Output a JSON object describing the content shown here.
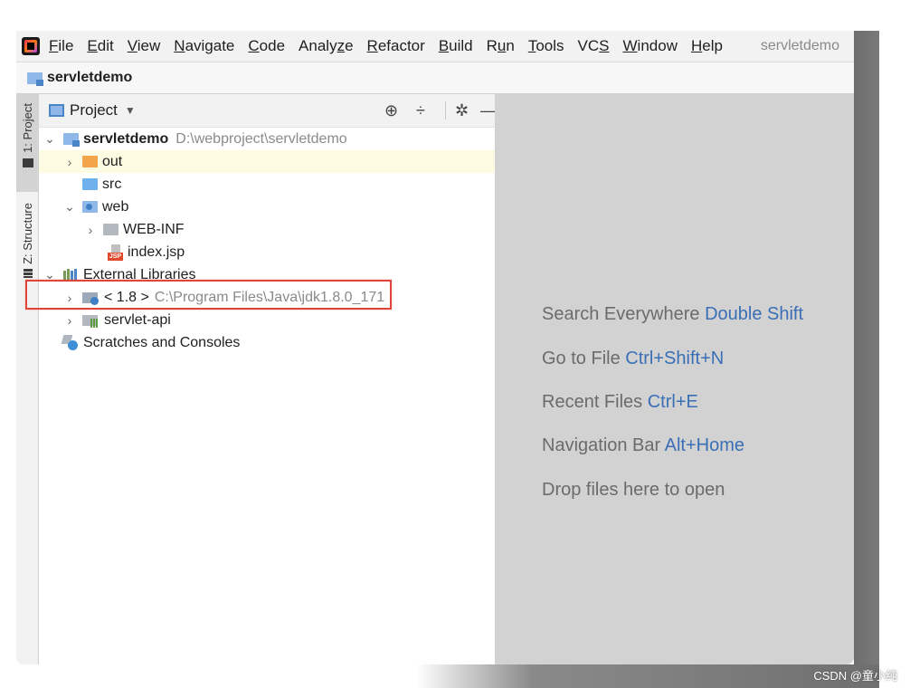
{
  "menubar": {
    "items": [
      {
        "pre": "",
        "u": "F",
        "post": "ile"
      },
      {
        "pre": "",
        "u": "E",
        "post": "dit"
      },
      {
        "pre": "",
        "u": "V",
        "post": "iew"
      },
      {
        "pre": "",
        "u": "N",
        "post": "avigate"
      },
      {
        "pre": "",
        "u": "C",
        "post": "ode"
      },
      {
        "pre": "Analy",
        "u": "z",
        "post": "e"
      },
      {
        "pre": "",
        "u": "R",
        "post": "efactor"
      },
      {
        "pre": "",
        "u": "B",
        "post": "uild"
      },
      {
        "pre": "R",
        "u": "u",
        "post": "n"
      },
      {
        "pre": "",
        "u": "T",
        "post": "ools"
      },
      {
        "pre": "VC",
        "u": "S",
        "post": ""
      },
      {
        "pre": "",
        "u": "W",
        "post": "indow"
      },
      {
        "pre": "",
        "u": "H",
        "post": "elp"
      }
    ],
    "project_title": "servletdemo"
  },
  "navbar": {
    "crumb": "servletdemo"
  },
  "toolstrip": {
    "project_tab": "1: Project",
    "structure_tab": "Z: Structure"
  },
  "panel": {
    "title": "Project",
    "icons": [
      "locate-icon",
      "collapse-all-icon",
      "gear-icon",
      "hide-icon"
    ]
  },
  "tree": {
    "root_name": "servletdemo",
    "root_path": "D:\\webproject\\servletdemo",
    "out": "out",
    "src": "src",
    "web": "web",
    "webinf": "WEB-INF",
    "index": "index.jsp",
    "external_libs": "External Libraries",
    "jdk_name": "< 1.8 >",
    "jdk_path": "C:\\Program Files\\Java\\jdk1.8.0_171",
    "servlet_api": "servlet-api",
    "scratches": "Scratches and Consoles"
  },
  "editor_hints": [
    {
      "text": "Search Everywhere",
      "key": "Double Shift"
    },
    {
      "text": "Go to File",
      "key": "Ctrl+Shift+N"
    },
    {
      "text": "Recent Files",
      "key": "Ctrl+E"
    },
    {
      "text": "Navigation Bar",
      "key": "Alt+Home"
    },
    {
      "text": "Drop files here to open",
      "key": ""
    }
  ],
  "watermark": "CSDN @童小纯",
  "colors": {
    "highlight_box": "#e0453a",
    "key_blue": "#3a6fb6",
    "selected_row": "#fdfbe2"
  }
}
